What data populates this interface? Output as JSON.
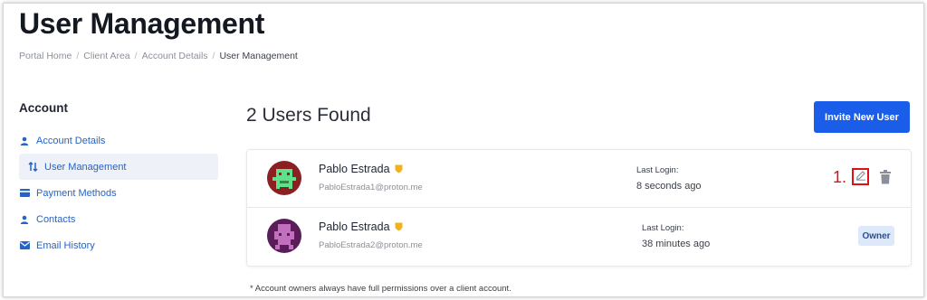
{
  "page": {
    "title": "User Management"
  },
  "breadcrumb": [
    "Portal Home",
    "Client Area",
    "Account Details",
    "User Management"
  ],
  "sidebar": {
    "title": "Account",
    "items": [
      {
        "label": "Account Details",
        "icon": "user-icon",
        "active": false
      },
      {
        "label": "User Management",
        "icon": "sort-arrows-icon",
        "active": true
      },
      {
        "label": "Payment Methods",
        "icon": "credit-card-icon",
        "active": false
      },
      {
        "label": "Contacts",
        "icon": "user-icon",
        "active": false
      },
      {
        "label": "Email History",
        "icon": "mail-icon",
        "active": false
      }
    ]
  },
  "main": {
    "users_found": "2 Users Found",
    "invite_label": "Invite New User",
    "annotation": "1.",
    "users": [
      {
        "name": "Pablo Estrada",
        "email": "PabloEstrada1@proton.me",
        "last_login_label": "Last Login:",
        "last_login": "8 seconds ago",
        "avatar_color": "#2f8a4c"
      },
      {
        "name": "Pablo Estrada",
        "email": "PabloEstrada2@proton.me",
        "last_login_label": "Last Login:",
        "last_login": "38 minutes ago",
        "avatar_color": "#7d2a7a",
        "badge": "Owner"
      }
    ],
    "footnote": "* Account owners always have full permissions over a client account."
  },
  "colors": {
    "accent": "#1a5de8",
    "link": "#2563c9",
    "shield": "#f2b318",
    "annotation": "#e0101a"
  }
}
